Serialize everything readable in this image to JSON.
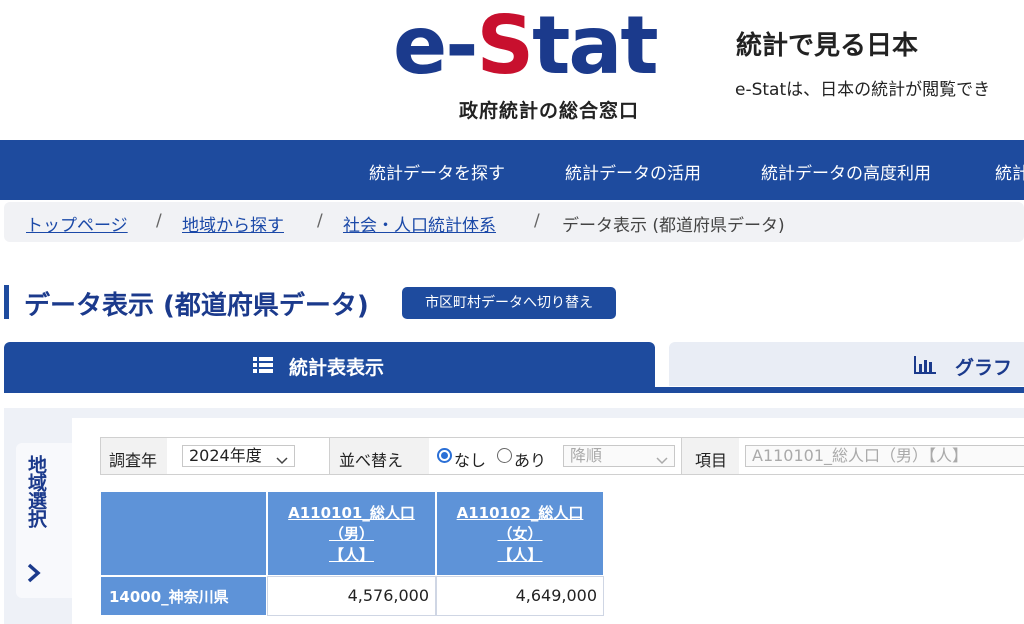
{
  "header": {
    "logo_e": "e-",
    "logo_s": "S",
    "logo_tat": "tat",
    "logo_sub": "政府統計の総合窓口",
    "tagline_title": "統計で見る日本",
    "tagline_desc": "e-Statは、日本の統計が閲覧でき"
  },
  "nav": {
    "items": [
      "統計データを探す",
      "統計データの活用",
      "統計データの高度利用",
      "統計"
    ]
  },
  "breadcrumb": {
    "items": [
      "トップページ",
      "地域から探す",
      "社会・人口統計体系"
    ],
    "separator": "/",
    "current": "データ表示 (都道府県データ)"
  },
  "page": {
    "title": "データ表示 (都道府県データ)",
    "switch_label": "市区町村データへ切り替え"
  },
  "tabs": {
    "table_label": "統計表表示",
    "graph_label": "グラフ"
  },
  "region_tab": {
    "label": "地域選択"
  },
  "filters": {
    "year_label": "調査年",
    "year_value": "2024年度",
    "sort_label": "並べ替え",
    "sort_none": "なし",
    "sort_yes": "あり",
    "sort_order": "降順",
    "item_label": "項目",
    "item_value": "A110101_総人口（男）【人】"
  },
  "table": {
    "columns": [
      {
        "l1": "A110101_総人口",
        "l2": "（男）",
        "l3": "【人】"
      },
      {
        "l1": "A110102_総人口",
        "l2": "（女）",
        "l3": "【人】"
      }
    ],
    "rows": [
      {
        "region": "14000_神奈川県",
        "values": [
          "4,576,000",
          "4,649,000"
        ]
      }
    ]
  },
  "colors": {
    "brand_blue": "#1e4b9e",
    "logo_red": "#c8102e",
    "table_header": "#5e93d8"
  }
}
